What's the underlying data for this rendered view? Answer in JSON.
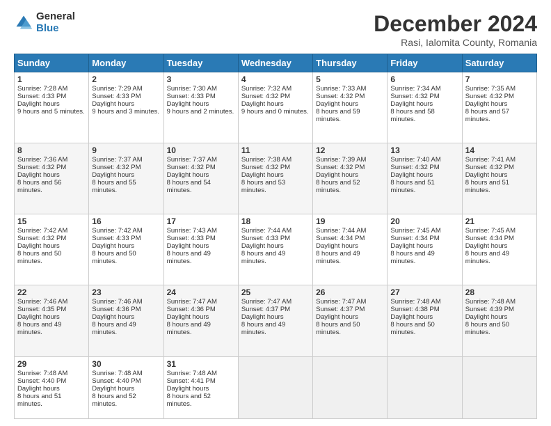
{
  "logo": {
    "general": "General",
    "blue": "Blue"
  },
  "title": "December 2024",
  "location": "Rasi, Ialomita County, Romania",
  "headers": [
    "Sunday",
    "Monday",
    "Tuesday",
    "Wednesday",
    "Thursday",
    "Friday",
    "Saturday"
  ],
  "weeks": [
    [
      {
        "day": "1",
        "sunrise": "7:28 AM",
        "sunset": "4:33 PM",
        "daylight": "9 hours and 5 minutes."
      },
      {
        "day": "2",
        "sunrise": "7:29 AM",
        "sunset": "4:33 PM",
        "daylight": "9 hours and 3 minutes."
      },
      {
        "day": "3",
        "sunrise": "7:30 AM",
        "sunset": "4:33 PM",
        "daylight": "9 hours and 2 minutes."
      },
      {
        "day": "4",
        "sunrise": "7:32 AM",
        "sunset": "4:32 PM",
        "daylight": "9 hours and 0 minutes."
      },
      {
        "day": "5",
        "sunrise": "7:33 AM",
        "sunset": "4:32 PM",
        "daylight": "8 hours and 59 minutes."
      },
      {
        "day": "6",
        "sunrise": "7:34 AM",
        "sunset": "4:32 PM",
        "daylight": "8 hours and 58 minutes."
      },
      {
        "day": "7",
        "sunrise": "7:35 AM",
        "sunset": "4:32 PM",
        "daylight": "8 hours and 57 minutes."
      }
    ],
    [
      {
        "day": "8",
        "sunrise": "7:36 AM",
        "sunset": "4:32 PM",
        "daylight": "8 hours and 56 minutes."
      },
      {
        "day": "9",
        "sunrise": "7:37 AM",
        "sunset": "4:32 PM",
        "daylight": "8 hours and 55 minutes."
      },
      {
        "day": "10",
        "sunrise": "7:37 AM",
        "sunset": "4:32 PM",
        "daylight": "8 hours and 54 minutes."
      },
      {
        "day": "11",
        "sunrise": "7:38 AM",
        "sunset": "4:32 PM",
        "daylight": "8 hours and 53 minutes."
      },
      {
        "day": "12",
        "sunrise": "7:39 AM",
        "sunset": "4:32 PM",
        "daylight": "8 hours and 52 minutes."
      },
      {
        "day": "13",
        "sunrise": "7:40 AM",
        "sunset": "4:32 PM",
        "daylight": "8 hours and 51 minutes."
      },
      {
        "day": "14",
        "sunrise": "7:41 AM",
        "sunset": "4:32 PM",
        "daylight": "8 hours and 51 minutes."
      }
    ],
    [
      {
        "day": "15",
        "sunrise": "7:42 AM",
        "sunset": "4:32 PM",
        "daylight": "8 hours and 50 minutes."
      },
      {
        "day": "16",
        "sunrise": "7:42 AM",
        "sunset": "4:33 PM",
        "daylight": "8 hours and 50 minutes."
      },
      {
        "day": "17",
        "sunrise": "7:43 AM",
        "sunset": "4:33 PM",
        "daylight": "8 hours and 49 minutes."
      },
      {
        "day": "18",
        "sunrise": "7:44 AM",
        "sunset": "4:33 PM",
        "daylight": "8 hours and 49 minutes."
      },
      {
        "day": "19",
        "sunrise": "7:44 AM",
        "sunset": "4:34 PM",
        "daylight": "8 hours and 49 minutes."
      },
      {
        "day": "20",
        "sunrise": "7:45 AM",
        "sunset": "4:34 PM",
        "daylight": "8 hours and 49 minutes."
      },
      {
        "day": "21",
        "sunrise": "7:45 AM",
        "sunset": "4:34 PM",
        "daylight": "8 hours and 49 minutes."
      }
    ],
    [
      {
        "day": "22",
        "sunrise": "7:46 AM",
        "sunset": "4:35 PM",
        "daylight": "8 hours and 49 minutes."
      },
      {
        "day": "23",
        "sunrise": "7:46 AM",
        "sunset": "4:36 PM",
        "daylight": "8 hours and 49 minutes."
      },
      {
        "day": "24",
        "sunrise": "7:47 AM",
        "sunset": "4:36 PM",
        "daylight": "8 hours and 49 minutes."
      },
      {
        "day": "25",
        "sunrise": "7:47 AM",
        "sunset": "4:37 PM",
        "daylight": "8 hours and 49 minutes."
      },
      {
        "day": "26",
        "sunrise": "7:47 AM",
        "sunset": "4:37 PM",
        "daylight": "8 hours and 50 minutes."
      },
      {
        "day": "27",
        "sunrise": "7:48 AM",
        "sunset": "4:38 PM",
        "daylight": "8 hours and 50 minutes."
      },
      {
        "day": "28",
        "sunrise": "7:48 AM",
        "sunset": "4:39 PM",
        "daylight": "8 hours and 50 minutes."
      }
    ],
    [
      {
        "day": "29",
        "sunrise": "7:48 AM",
        "sunset": "4:40 PM",
        "daylight": "8 hours and 51 minutes."
      },
      {
        "day": "30",
        "sunrise": "7:48 AM",
        "sunset": "4:40 PM",
        "daylight": "8 hours and 52 minutes."
      },
      {
        "day": "31",
        "sunrise": "7:48 AM",
        "sunset": "4:41 PM",
        "daylight": "8 hours and 52 minutes."
      },
      null,
      null,
      null,
      null
    ]
  ]
}
